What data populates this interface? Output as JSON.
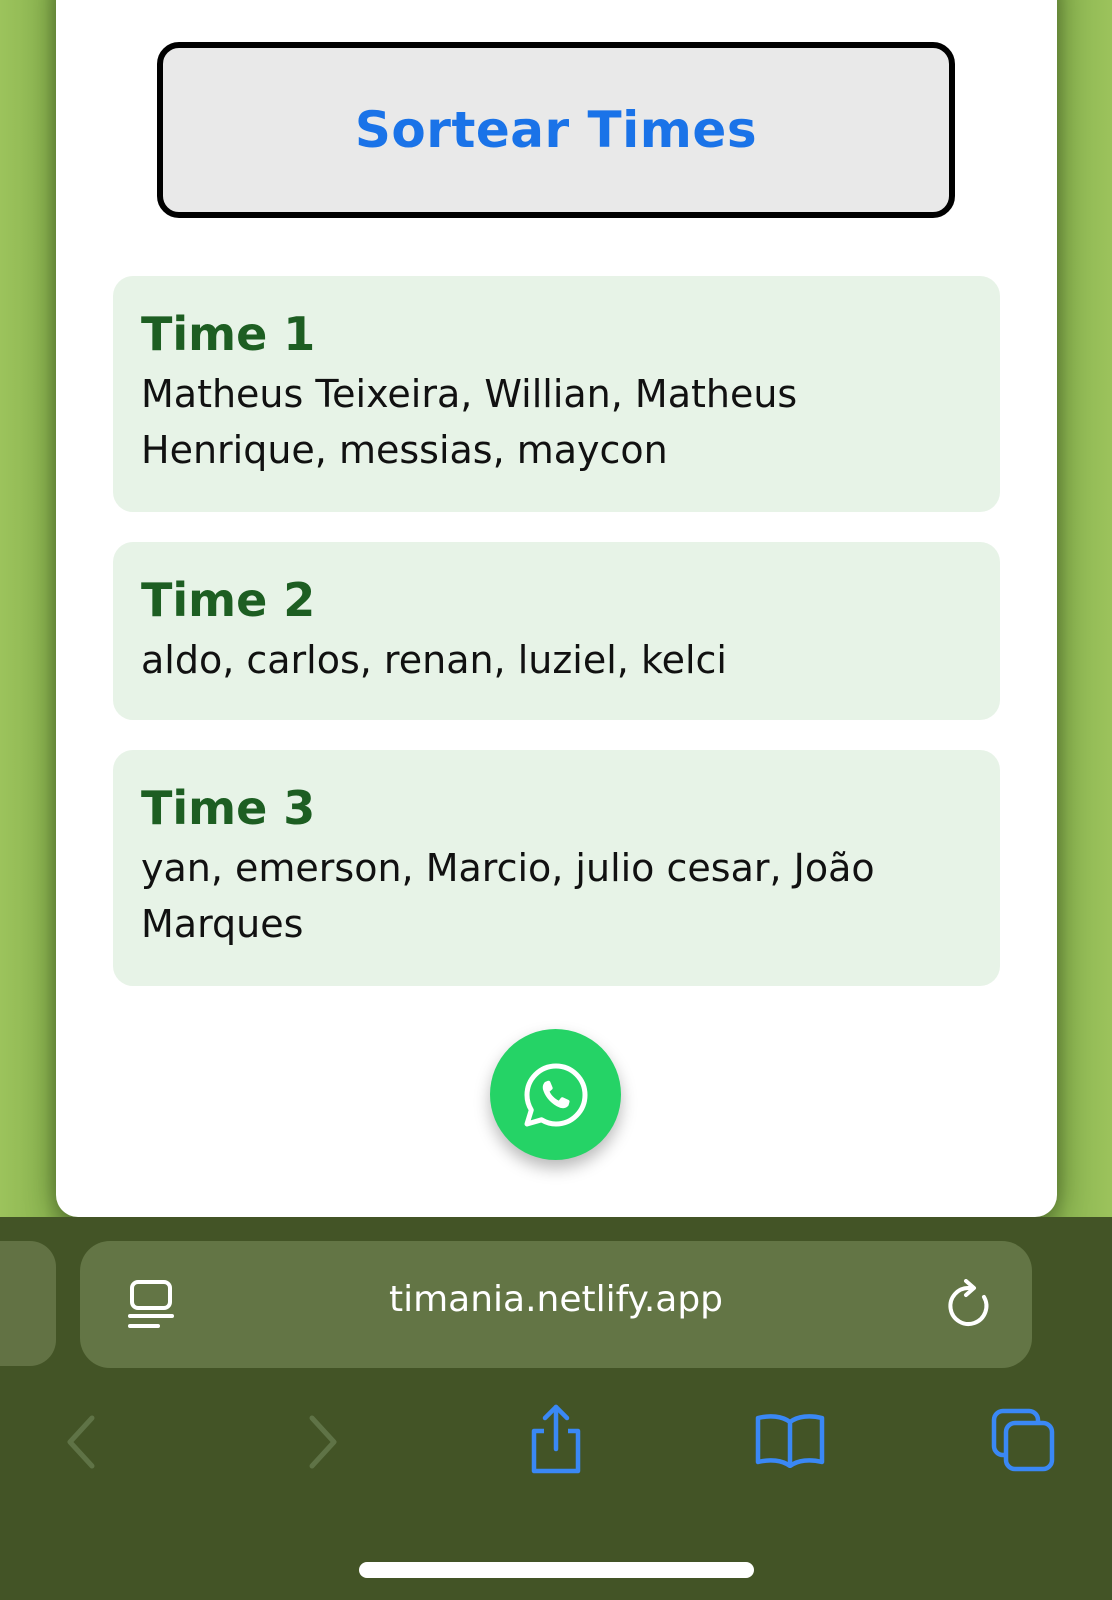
{
  "app": {
    "sort_button_label": "Sortear Times"
  },
  "teams": [
    {
      "title": "Time 1",
      "players": "Matheus Teixeira, Willian, Matheus Henrique, messias, maycon"
    },
    {
      "title": "Time 2",
      "players": "aldo, carlos, renan, luziel, kelci"
    },
    {
      "title": "Time 3",
      "players": "yan, emerson, Marcio, julio cesar, João Marques"
    }
  ],
  "share": {
    "icon": "whatsapp-icon",
    "color": "#25d366"
  },
  "browser": {
    "url": "timania.netlify.app",
    "toolbar_icons": [
      "page-menu-icon",
      "reload-icon",
      "back-icon",
      "forward-icon",
      "share-icon",
      "bookmarks-icon",
      "tabs-icon"
    ]
  },
  "colors": {
    "accent_blue": "#1a73e8",
    "team_title_green": "#1d5e22",
    "team_card_bg": "#e7f3e7",
    "browser_bg": "#435426"
  }
}
